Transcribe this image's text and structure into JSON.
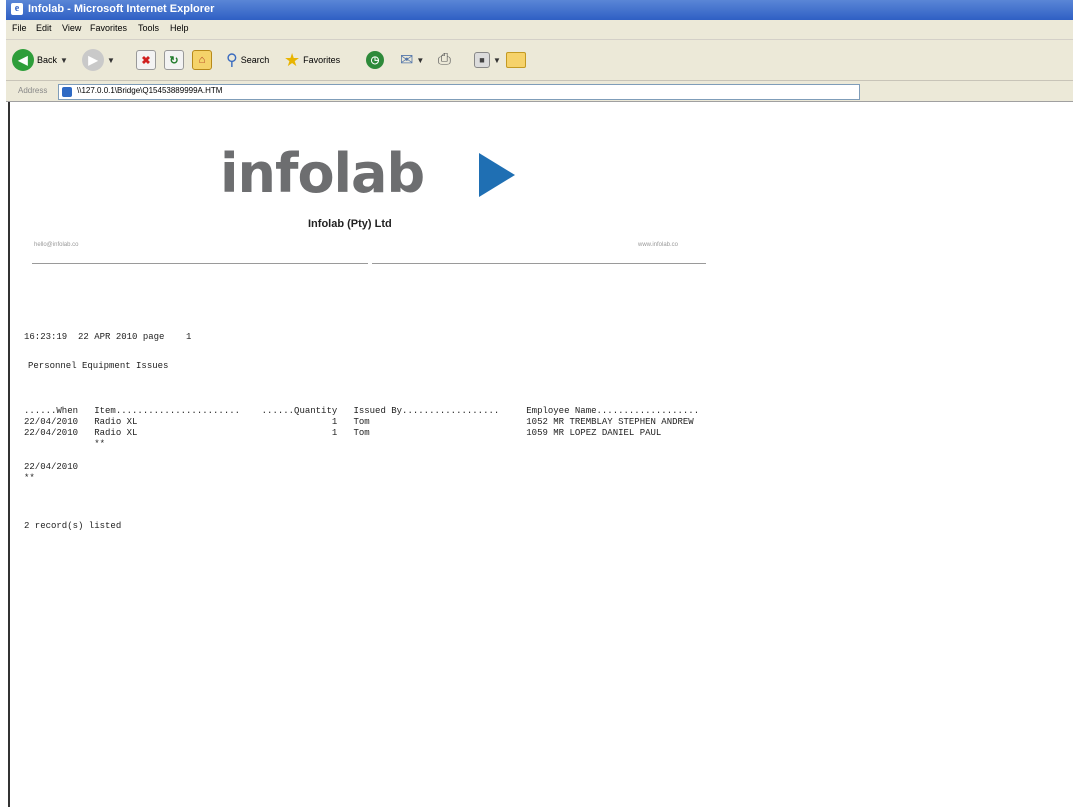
{
  "window": {
    "title": "Infolab - Microsoft Internet Explorer"
  },
  "menubar": {
    "items": [
      "File",
      "Edit",
      "View",
      "Favorites",
      "Tools",
      "Help"
    ]
  },
  "toolbar": {
    "back_label": "Back",
    "search_label": "Search",
    "favorites_label": "Favorites"
  },
  "address": {
    "label": "Address",
    "url": "\\\\127.0.0.1\\Bridge\\Q15453889999A.HTM"
  },
  "report": {
    "logo_text": "infolab",
    "company": "Infolab (Pty) Ltd",
    "email": "hello@infolab.co",
    "website": "www.infolab.co",
    "timestamp_line": "16:23:19  22 APR 2010 page    1",
    "report_title": "Personnel Equipment Issues",
    "header_line": "......When   Item.......................    ......Quantity   Issued By..................     Employee Name...................",
    "rows": [
      "22/04/2010   Radio XL                                    1   Tom                             1052 MR TREMBLAY STEPHEN ANDREW",
      "22/04/2010   Radio XL                                    1   Tom                             1059 MR LOPEZ DANIEL PAUL"
    ],
    "subtotal_marker": "             **",
    "group_date": "22/04/2010",
    "group_marker": "**",
    "footer": "2 record(s) listed"
  }
}
